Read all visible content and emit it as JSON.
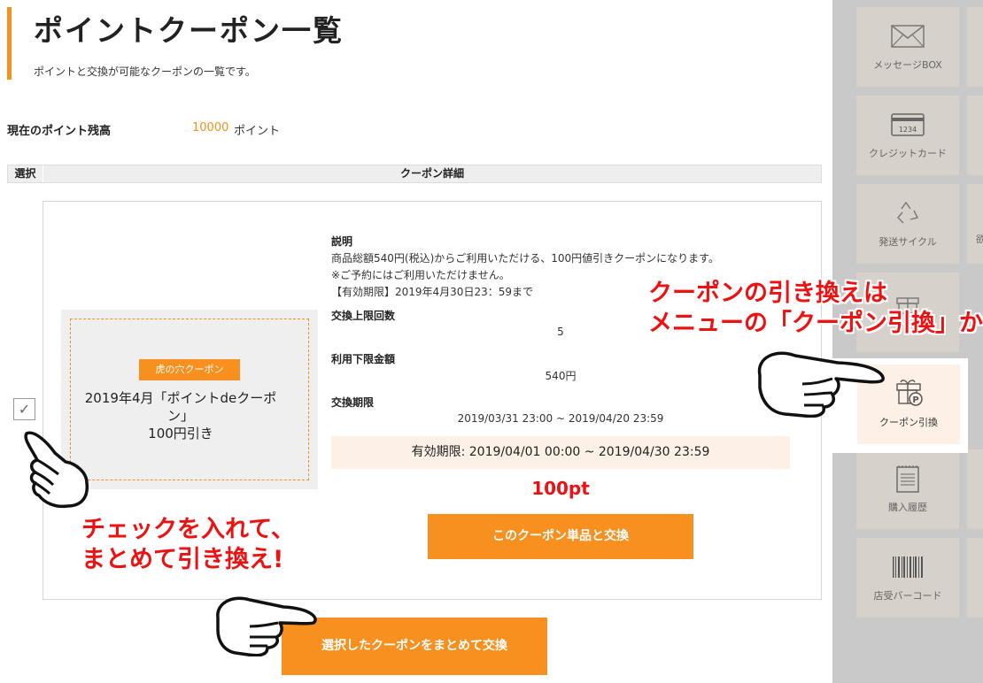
{
  "header": {
    "title": "ポイントクーポン一覧",
    "subtitle": "ポイントと交換が可能なクーポンの一覧です。"
  },
  "balance": {
    "label": "現在のポイント残高",
    "value": "10000",
    "unit": "ポイント"
  },
  "table": {
    "col_select": "選択",
    "col_detail": "クーポン詳細"
  },
  "coupon": {
    "checked": true,
    "checkbox_mark": "✓",
    "badge": "虎の穴クーポン",
    "name": "2019年4月「ポイントdeクーポン」",
    "discount": "100円引き",
    "description_heading": "説明",
    "description_line1": "商品総額540円(税込)からご利用いただける、100円値引きクーポンになります。",
    "description_line2": "※ご予約にはご利用いただけません。",
    "description_line3": "【有効期限】2019年4月30日23：59まで",
    "limit_heading": "交換上限回数",
    "limit_value": "5",
    "min_amount_heading": "利用下限金額",
    "min_amount_value": "540円",
    "exchange_period_heading": "交換期限",
    "exchange_period_value": "2019/03/31 23:00 ~ 2019/04/20 23:59",
    "validity": "有効期限: 2019/04/01 00:00 ~ 2019/04/30 23:59",
    "price": "100pt",
    "exchange_single_label": "このクーポン単品と交換"
  },
  "actions": {
    "exchange_bulk_label": "選択したクーポンをまとめて交換"
  },
  "sidebar": {
    "items": [
      {
        "label": "メッセージBOX",
        "icon": "envelope-icon"
      },
      {
        "label": "クレジットカード",
        "icon": "credit-card-icon"
      },
      {
        "label": "発送サイクル",
        "icon": "recycle-icon"
      },
      {
        "label": "",
        "icon": "gift-icon"
      },
      {
        "label": "クーポン引換",
        "icon": "coupon-exchange-icon"
      },
      {
        "label": "購入履歴",
        "icon": "receipt-icon"
      },
      {
        "label": "店受バーコード",
        "icon": "barcode-icon"
      }
    ],
    "card_number": "1234",
    "partial_label": "欲"
  },
  "annotations": {
    "right_line1": "クーポンの引き換えは",
    "right_line2": "メニューの「クーポン引換」から",
    "left_line1": "チェックを入れて、",
    "left_line2": "まとめて引き換え!"
  },
  "colors": {
    "accent": "#f7901e",
    "price": "#ee1111",
    "highlight_bg": "#fdf0e6"
  }
}
